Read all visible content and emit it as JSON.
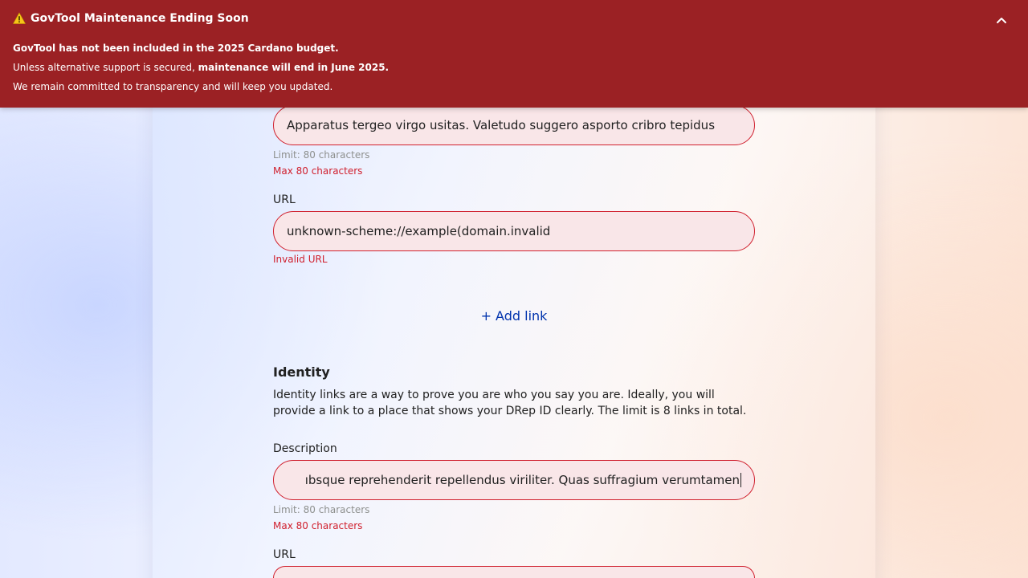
{
  "banner": {
    "title": "GovTool Maintenance Ending Soon",
    "line1": "GovTool has not been included in the 2025 Cardano budget.",
    "line2_prefix": "Unless alternative support is secured, ",
    "line2_bold": "maintenance will end in June 2025.",
    "line3": "We remain committed to transparency and will keep you updated.",
    "color": "#9b2124"
  },
  "links_section": {
    "description_field": {
      "value": "Apparatus tergeo virgo usitas. Valetudo suggero asporto cribro tepidus",
      "hint": "Limit: 80 characters",
      "error": "Max 80 characters"
    },
    "url_field": {
      "label": "URL",
      "value": "unknown-scheme://example(domain.invalid",
      "error": "Invalid URL"
    },
    "add_link_label": "+ Add link"
  },
  "identity_section": {
    "title": "Identity",
    "description": "Identity links are a way to prove you are who you say you are. Ideally, you will provide a link to a place that shows your DRep ID clearly. The limit is 8 links in total.",
    "description_field": {
      "label": "Description",
      "value": "ıbsque reprehenderit repellendus viriliter. Quas suffragium verumtamen",
      "hint": "Limit: 80 characters",
      "error": "Max 80 characters"
    },
    "url_field": {
      "label": "URL"
    }
  },
  "colors": {
    "error": "#d0202e",
    "link": "#0033ad",
    "input_bg": "#f9e6e8"
  }
}
